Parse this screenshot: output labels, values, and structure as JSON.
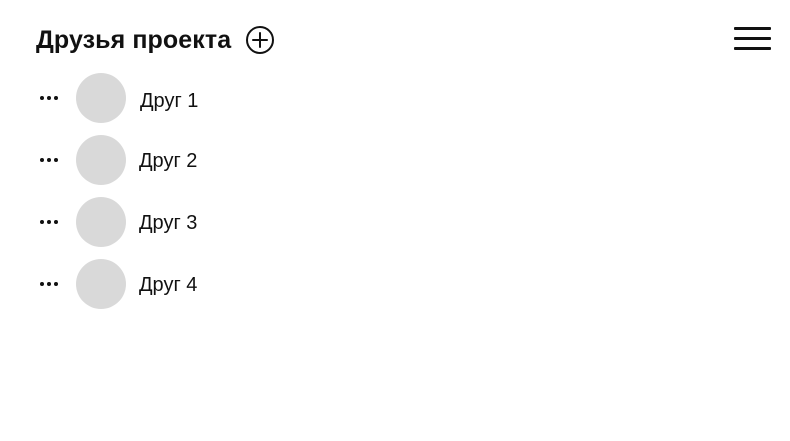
{
  "header": {
    "title": "Друзья проекта",
    "add_icon": "circle-plus-icon"
  },
  "top_bar": {
    "menu_icon": "hamburger-menu-icon"
  },
  "friends": [
    {
      "name": "Друг 1",
      "actions_icon": "more-horizontal-icon"
    },
    {
      "name": "Друг 2",
      "actions_icon": "more-horizontal-icon"
    },
    {
      "name": "Друг 3",
      "actions_icon": "more-horizontal-icon"
    },
    {
      "name": "Друг 4",
      "actions_icon": "more-horizontal-icon"
    }
  ],
  "colors": {
    "text": "#111111",
    "avatar": "#d9d9d9",
    "background": "#ffffff"
  }
}
